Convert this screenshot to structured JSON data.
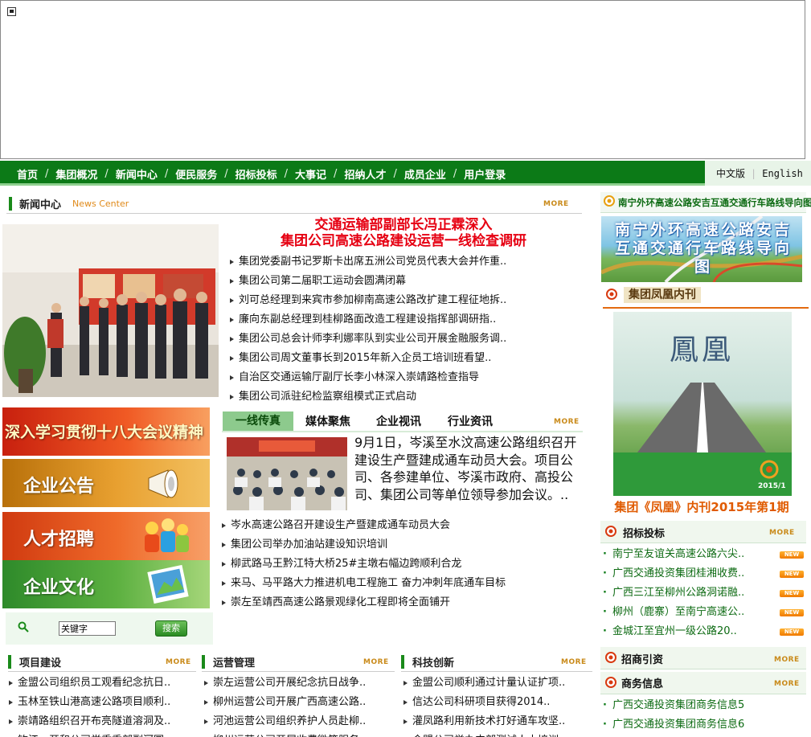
{
  "nav": {
    "items": [
      "首页",
      "集团概况",
      "新闻中心",
      "便民服务",
      "招标投标",
      "大事记",
      "招纳人才",
      "成员企业",
      "用户登录"
    ],
    "sep": "/",
    "lang_cn": "中文版",
    "lang_sep": "|",
    "lang_en": "English"
  },
  "news_center": {
    "title": "新闻中心",
    "subtitle": "News Center",
    "more": "MORE",
    "headline_line1": "交通运输部副部长冯正霖深入",
    "headline_line2": "集团公司高速公路建设运营一线检查调研",
    "items": [
      "集团党委副书记罗斯卡出席五洲公司党员代表大会并作重..",
      "集团公司第二届职工运动会圆满闭幕",
      "刘可总经理到来宾市参加柳南高速公路改扩建工程征地拆..",
      "廉向东副总经理到桂柳路面改造工程建设指挥部调研指..",
      "集团公司总会计师李利娜率队到实业公司开展金融服务调..",
      "集团公司周文董事长到2015年新入企员工培训班看望..",
      "自治区交通运输厅副厅长李小林深入崇靖路检查指导",
      "集团公司派驻纪检监察组模式正式启动"
    ]
  },
  "promos": [
    "深入学习贯彻十八大会议精神",
    "企业公告",
    "人才招聘",
    "企业文化"
  ],
  "search": {
    "placeholder": "关键字",
    "button": "搜索"
  },
  "tabs": {
    "labels": [
      "一线传真",
      "媒体聚焦",
      "企业视讯",
      "行业资讯"
    ],
    "more": "MORE",
    "feature_text": "9月1日，岑溪至水汶高速公路组织召开建设生产暨建成通车动员大会。项目公司、各参建单位、岑溪市政府、高投公司、集团公司等单位领导参加会议。..",
    "items": [
      "岑水高速公路召开建设生产暨建成通车动员大会",
      "集团公司举办加油站建设知识培训",
      "柳武路马王黔江特大桥25#主墩右幅边跨顺利合龙",
      "来马、马平路大力推进机电工程施工 奋力冲刺年底通车目标",
      "崇左至靖西高速公路景观绿化工程即将全面铺开"
    ]
  },
  "right": {
    "route_title": "南宁外环高速公路安吉互通交通行车路线导向图",
    "route_image_text": "南宁外环高速公路安吉互通交通行车路线导向图",
    "magazine_title": "集团凤凰内刊",
    "magazine_cover_title": "鳳凰",
    "magazine_cover_tag": "2015/1",
    "magazine_caption": "集团《凤凰》内刊2015年第1期",
    "bidding_title": "招标投标",
    "bidding_more": "MORE",
    "bidding_items": [
      "南宁至友谊关高速公路六尖..",
      "广西交通投资集团桂湘收费..",
      "广西三江至柳州公路洞诺融..",
      "柳州（鹿寨）至南宁高速公..",
      "金城江至宜州一级公路20.."
    ],
    "new_badge": "NEW",
    "invest_title": "招商引资",
    "invest_more": "MORE",
    "business_title": "商务信息",
    "business_more": "MORE",
    "business_items": [
      "广西交通投资集团商务信息5",
      "广西交通投资集团商务信息6"
    ]
  },
  "bottom": {
    "projects": {
      "title": "项目建设",
      "more": "MORE",
      "items": [
        "金盟公司组织员工观看纪念抗日..",
        "玉林至铁山港高速公路项目顺利..",
        "崇靖路组织召开布亮隧道溶洞及..",
        "钦江…开和公司党委委部副河圆…"
      ]
    },
    "operations": {
      "title": "运营管理",
      "more": "MORE",
      "items": [
        "崇左运营公司开展纪念抗日战争..",
        "柳州运营公司开展广西高速公路..",
        "河池运营公司组织养护人员赴柳..",
        "柳州运营公司开展收费微笑服务.."
      ]
    },
    "tech": {
      "title": "科技创新",
      "more": "MORE",
      "items": [
        "金盟公司顺利通过计量认证扩项..",
        "信达公司科研项目获得2014..",
        "灌凤路利用新技术打好通车攻坚..",
        "金盟公司举办内部测试人士培训.."
      ]
    }
  },
  "colors": {
    "nav_green": "#0c7a17",
    "headline_red": "#e60012",
    "accent_orange": "#e05a00"
  }
}
